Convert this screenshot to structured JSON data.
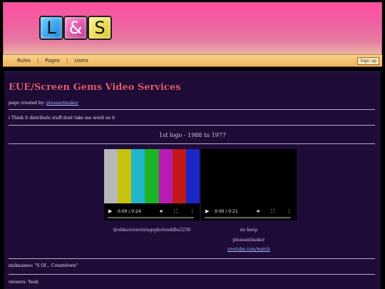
{
  "header": {
    "logo_letters": [
      "L",
      "&",
      "S"
    ],
    "nav": [
      "Rules",
      "Pages",
      "Users"
    ],
    "signup_label": "Sign up"
  },
  "page": {
    "title": "EUE/Screen Gems Video Services",
    "credit_prefix": "page created by:",
    "credit_user": "pleasantmaker",
    "note": "i Think it distribute stuff dont take me word on it",
    "section_title": "1st logo - 1988 to 1977"
  },
  "videos": [
    {
      "time": "0:00 / 0:24",
      "progress": 0.0,
      "bar_colors": [
        "#b7b7b7",
        "#c6c20d",
        "#21b6c9",
        "#1fb327",
        "#b91cb4",
        "#c11818",
        "#1a28c6"
      ],
      "caption": "@oldscreenvintagephotosddbs2230"
    },
    {
      "time": "0:00 / 0:21",
      "progress": 0.0,
      "captions": [
        "no beep",
        "pleasantmaker"
      ],
      "link": "youtube.com/watch"
    }
  ],
  "footer": {
    "nicknames": "nicknames: \"S Of... Countdown\"",
    "viewers": "viewers: Yeah"
  },
  "icons": {
    "play": "play-icon",
    "volume": "volume-icon",
    "fullscreen": "fullscreen-icon",
    "menu": "more-vert-icon"
  }
}
